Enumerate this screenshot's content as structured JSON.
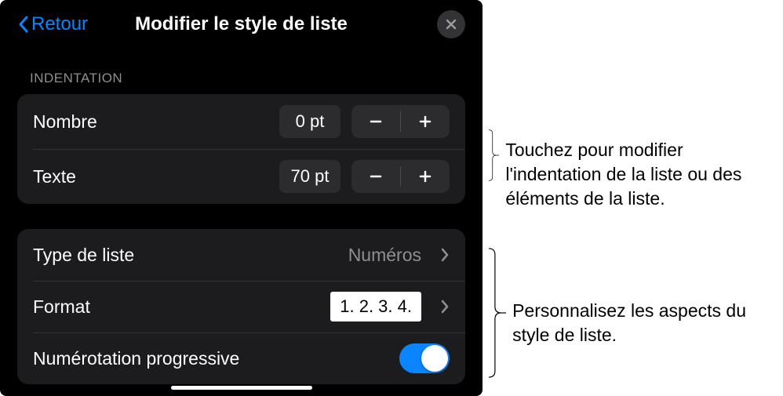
{
  "header": {
    "back": "Retour",
    "title": "Modifier le style de liste"
  },
  "indentation": {
    "sectionTitle": "INDENTATION",
    "rows": {
      "nombre": {
        "label": "Nombre",
        "value": "0 pt"
      },
      "texte": {
        "label": "Texte",
        "value": "70 pt"
      }
    }
  },
  "listStyle": {
    "typeDeListe": {
      "label": "Type de liste",
      "value": "Numéros"
    },
    "format": {
      "label": "Format",
      "preview": "1. 2. 3. 4."
    },
    "numerotationProgressive": {
      "label": "Numérotation progressive",
      "on": true
    }
  },
  "callouts": {
    "indent": "Touchez pour modifier l'indentation de la liste ou des éléments de la liste.",
    "style": "Personnalisez les aspects du style de liste."
  }
}
